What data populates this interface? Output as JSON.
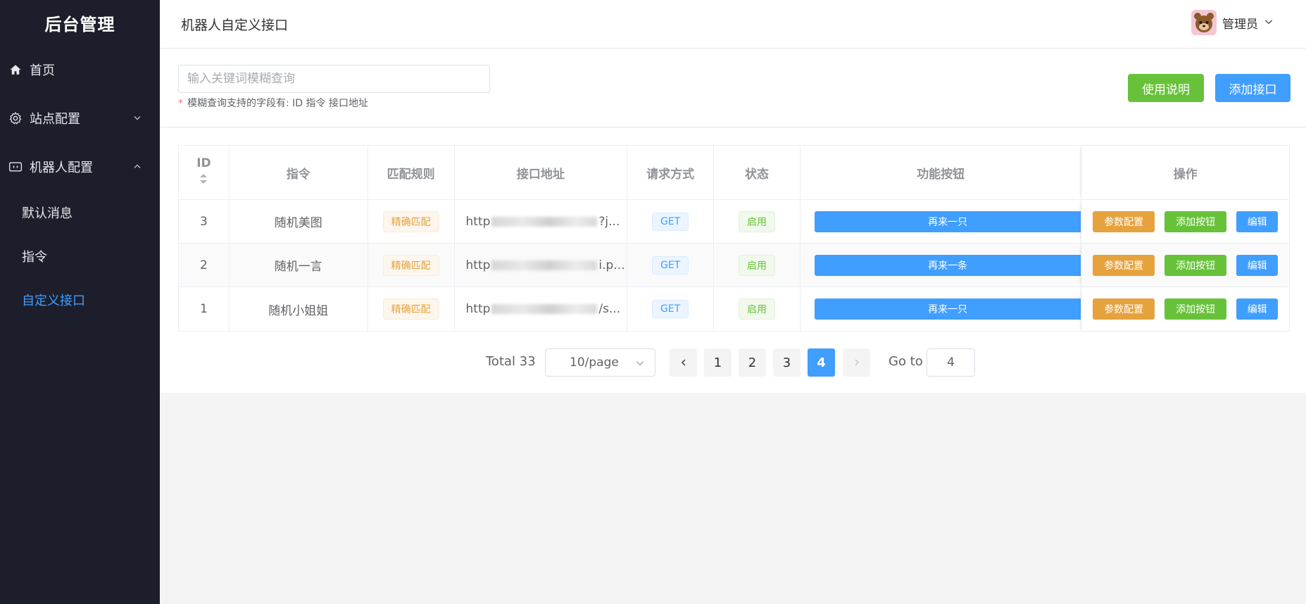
{
  "sidebar": {
    "brand": "后台管理",
    "items": [
      {
        "label": "首页",
        "icon": "home-icon"
      },
      {
        "label": "站点配置",
        "icon": "gear-icon",
        "expanded": false
      },
      {
        "label": "机器人配置",
        "icon": "robot-icon",
        "expanded": true
      }
    ],
    "sub_items": [
      {
        "label": "默认消息"
      },
      {
        "label": "指令"
      },
      {
        "label": "自定义接口",
        "active": true
      }
    ]
  },
  "header": {
    "title": "机器人自定义接口",
    "user": "管理员"
  },
  "search": {
    "placeholder": "输入关键词模糊查询",
    "value": "",
    "hint_star": "*",
    "hint": "模糊查询支持的字段有: ID 指令 接口地址"
  },
  "toolbar": {
    "help_label": "使用说明",
    "add_label": "添加接口"
  },
  "table": {
    "columns": [
      "ID",
      "指令",
      "匹配规则",
      "接口地址",
      "请求方式",
      "状态",
      "功能按钮",
      "操作"
    ],
    "rows": [
      {
        "id": "3",
        "command": "随机美图",
        "rule": "精确匹配",
        "url_prefix": "http",
        "url_suffix": "?j...",
        "method": "GET",
        "status": "启用",
        "func_button": "再来一只",
        "op_param": "参数配置",
        "op_add_btn": "添加按钮",
        "op_edit": "编辑"
      },
      {
        "id": "2",
        "command": "随机一言",
        "rule": "精确匹配",
        "url_prefix": "http",
        "url_suffix": "i.p...",
        "method": "GET",
        "status": "启用",
        "func_button": "再来一条",
        "op_param": "参数配置",
        "op_add_btn": "添加按钮",
        "op_edit": "编辑"
      },
      {
        "id": "1",
        "command": "随机小姐姐",
        "rule": "精确匹配",
        "url_prefix": "http",
        "url_suffix": "/s...",
        "method": "GET",
        "status": "启用",
        "func_button": "再来一只",
        "op_param": "参数配置",
        "op_add_btn": "添加按钮",
        "op_edit": "编辑"
      }
    ]
  },
  "pagination": {
    "total": "Total 33",
    "page_size": "10/page",
    "pages": [
      "1",
      "2",
      "3",
      "4"
    ],
    "current": "4",
    "goto_label": "Go to",
    "goto_value": "4"
  },
  "colors": {
    "primary": "#409eff",
    "success": "#67c23a",
    "warning": "#e6a23c",
    "sidebar_bg": "#1d1e2b"
  }
}
